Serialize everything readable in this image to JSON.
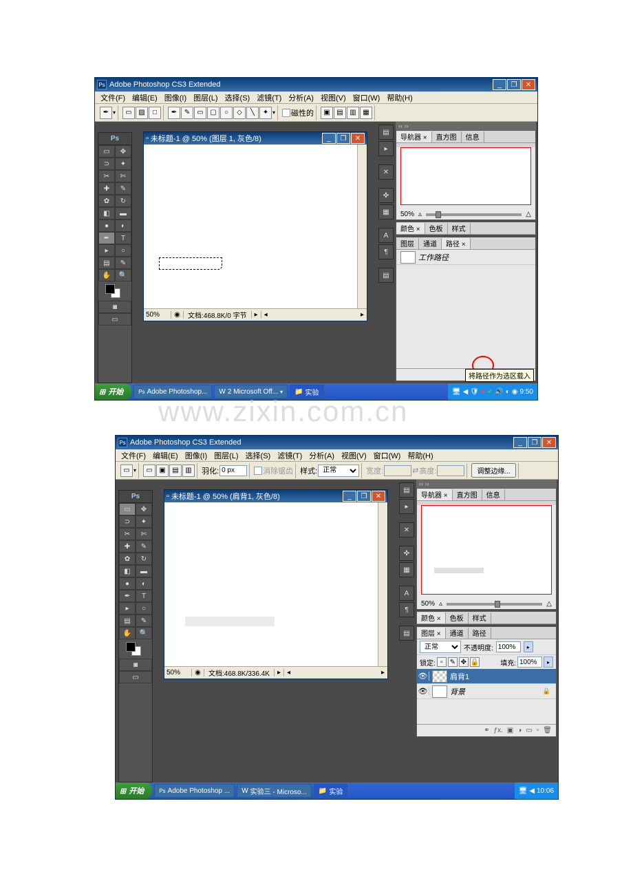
{
  "screenshot1": {
    "title": "Adobe Photoshop CS3 Extended",
    "menus": [
      "文件(F)",
      "编辑(E)",
      "图像(I)",
      "图层(L)",
      "选择(S)",
      "滤镜(T)",
      "分析(A)",
      "视图(V)",
      "窗口(W)",
      "帮助(H)"
    ],
    "options": {
      "magnetic": "磁性的"
    },
    "canvas": {
      "title": "未标题-1 @ 50% (图层 1, 灰色/8)",
      "zoom": "50%",
      "doc": "文档:468.8K/0 字节"
    },
    "panels": {
      "nav_tabs": [
        "导航器 ×",
        "直方图",
        "信息"
      ],
      "nav_zoom": "50%",
      "color_tabs": [
        "颜色 ×",
        "色板",
        "样式"
      ],
      "path_tabs": [
        "图层",
        "通道",
        "路径 ×"
      ],
      "work_path": "工作路径"
    },
    "tooltip": "将路径作为选区载入",
    "taskbar": {
      "start": "开始",
      "app1": "Adobe Photoshop...",
      "app2": "2 Microsoft Off...",
      "folder": "实验",
      "time": "9:50"
    }
  },
  "watermark": "www.zixin.com.cn",
  "screenshot2": {
    "title": "Adobe Photoshop CS3 Extended",
    "menus": [
      "文件(F)",
      "编辑(E)",
      "图像(I)",
      "图层(L)",
      "选择(S)",
      "滤镜(T)",
      "分析(A)",
      "视图(V)",
      "窗口(W)",
      "帮助(H)"
    ],
    "options": {
      "feather_label": "羽化:",
      "feather_value": "0 px",
      "antialias": "消除锯齿",
      "style_label": "样式:",
      "style_value": "正常",
      "width_label": "宽度:",
      "height_label": "高度:",
      "refine": "调整边缘..."
    },
    "canvas": {
      "title": "未标题-1 @ 50% (肩背1, 灰色/8)",
      "zoom": "50%",
      "doc": "文档:468.8K/336.4K"
    },
    "panels": {
      "nav_tabs": [
        "导航器 ×",
        "直方图",
        "信息"
      ],
      "nav_zoom": "50%",
      "color_tabs": [
        "颜色 ×",
        "色板",
        "样式"
      ],
      "layer_tabs": [
        "图层 ×",
        "通道",
        "路径"
      ],
      "blend": "正常",
      "opacity_label": "不透明度:",
      "opacity_value": "100%",
      "lock_label": "锁定:",
      "fill_label": "填充:",
      "fill_value": "100%",
      "layer1": "肩背1",
      "layer_bg": "背景"
    },
    "taskbar": {
      "start": "开始",
      "app1": "Adobe Photoshop ...",
      "app2": "实验三 - Microso...",
      "folder": "实验",
      "time": "10:06"
    }
  }
}
